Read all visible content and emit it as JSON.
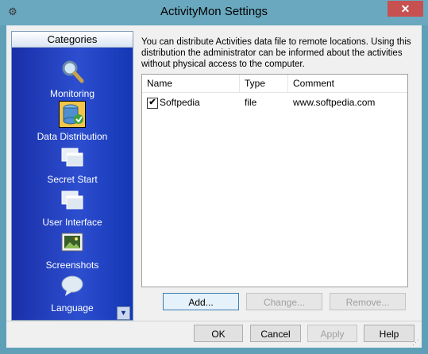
{
  "window": {
    "title": "ActivityMon Settings",
    "close_glyph": "✕",
    "app_icon": "gear-icon"
  },
  "sidebar": {
    "header": "Categories",
    "items": [
      {
        "label": "Monitoring",
        "icon": "magnifier-icon",
        "selected": false
      },
      {
        "label": "Data Distribution",
        "icon": "database-icon",
        "selected": true
      },
      {
        "label": "Secret Start",
        "icon": "windows-icon",
        "selected": false
      },
      {
        "label": "User Interface",
        "icon": "windows-icon",
        "selected": false
      },
      {
        "label": "Screenshots",
        "icon": "picture-icon",
        "selected": false
      },
      {
        "label": "Language",
        "icon": "speech-bubble-icon",
        "selected": false
      }
    ],
    "scroll_glyph": "▼"
  },
  "main": {
    "description": "You can distribute Activities data file to remote locations. Using this distribution the administrator can be informed about the activities without physical access to the computer.",
    "columns": [
      "Name",
      "Type",
      "Comment"
    ],
    "rows": [
      {
        "checked": true,
        "check_glyph": "✔",
        "name": "Softpedia",
        "type": "file",
        "comment": "www.softpedia.com"
      }
    ],
    "buttons": {
      "add": "Add...",
      "change": "Change...",
      "remove": "Remove..."
    }
  },
  "footer": {
    "ok": "OK",
    "cancel": "Cancel",
    "apply": "Apply",
    "help": "Help"
  }
}
